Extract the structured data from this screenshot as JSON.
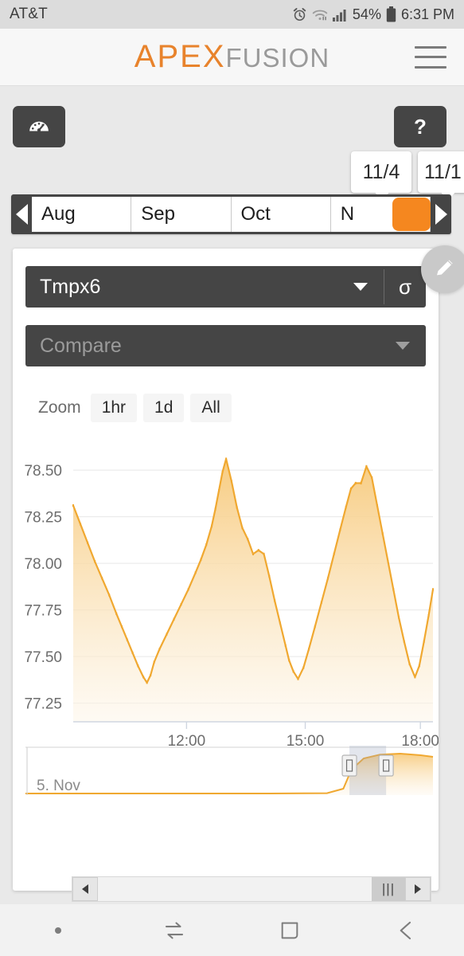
{
  "statusbar": {
    "carrier": "AT&T",
    "battery_percent": "54%",
    "clock": "6:31 PM",
    "icons": [
      "alarm-icon",
      "wifi-icon",
      "signal-icon",
      "battery-icon"
    ]
  },
  "header": {
    "brand_primary": "APEX",
    "brand_secondary": "FUSION",
    "menu_icon": "hamburger-icon",
    "brand_color": "#e8832c"
  },
  "toolbar": {
    "dashboard_icon": "gauge-icon",
    "help_label": "?"
  },
  "date_badges": [
    {
      "label": "11/4"
    },
    {
      "label": "11/1"
    }
  ],
  "month_strip": {
    "prev_icon": "chevron-left-icon",
    "next_icon": "chevron-right-icon",
    "months": [
      "Aug",
      "Sep",
      "Oct",
      "N"
    ],
    "knob_color": "#f5871f"
  },
  "card": {
    "probe_select": {
      "value": "Tmpx6",
      "caret_icon": "chevron-down-icon",
      "sigma_label": "σ"
    },
    "compare_select": {
      "placeholder": "Compare",
      "caret_icon": "chevron-down-icon"
    },
    "zoom": {
      "label": "Zoom",
      "buttons": [
        "1hr",
        "1d",
        "All"
      ]
    },
    "edit_fab_icon": "pencil-icon"
  },
  "navigator": {
    "series_label": "5. Nov",
    "left_arrow_icon": "arrow-left-icon",
    "right_arrow_icon": "arrow-right-icon",
    "thumb_grip": "|||",
    "handle_grip": "||"
  },
  "android_nav": {
    "buttons": [
      "dot-icon",
      "recents-icon",
      "home-icon",
      "back-icon"
    ]
  },
  "chart_data": {
    "type": "area",
    "title": "Tmpx6",
    "xlabel": "",
    "ylabel": "",
    "line_color": "#f0a830",
    "fill_top": "#f7c97a",
    "fill_bottom": "#fdf6ea",
    "ylim": [
      77.15,
      78.62
    ],
    "yticks": [
      78.5,
      78.25,
      78.0,
      77.75,
      77.5,
      77.25
    ],
    "ytick_labels": [
      "78.50",
      "78.25",
      "78.00",
      "77.75",
      "77.50",
      "77.25"
    ],
    "xticks": [
      "12:00",
      "15:00",
      "18:00"
    ],
    "xtick_positions": [
      0.315,
      0.645,
      0.965
    ],
    "grid": true,
    "legend": "none",
    "x": [
      0.0,
      0.02,
      0.04,
      0.06,
      0.08,
      0.1,
      0.12,
      0.135,
      0.15,
      0.165,
      0.18,
      0.195,
      0.205,
      0.215,
      0.225,
      0.24,
      0.26,
      0.28,
      0.3,
      0.32,
      0.34,
      0.355,
      0.37,
      0.385,
      0.395,
      0.405,
      0.415,
      0.425,
      0.44,
      0.455,
      0.47,
      0.485,
      0.5,
      0.515,
      0.53,
      0.545,
      0.56,
      0.575,
      0.59,
      0.6,
      0.612,
      0.625,
      0.64,
      0.655,
      0.672,
      0.69,
      0.708,
      0.725,
      0.742,
      0.758,
      0.772,
      0.785,
      0.8,
      0.815,
      0.83,
      0.845,
      0.86,
      0.875,
      0.89,
      0.905,
      0.92,
      0.935,
      0.95,
      0.962,
      0.975,
      0.988,
      1.0
    ],
    "y": [
      78.31,
      78.21,
      78.11,
      78.01,
      77.92,
      77.83,
      77.73,
      77.66,
      77.59,
      77.52,
      77.45,
      77.39,
      77.36,
      77.4,
      77.47,
      77.54,
      77.62,
      77.7,
      77.78,
      77.86,
      77.95,
      78.02,
      78.1,
      78.2,
      78.29,
      78.39,
      78.49,
      78.56,
      78.44,
      78.3,
      78.19,
      78.13,
      78.05,
      78.07,
      78.05,
      77.93,
      77.8,
      77.68,
      77.56,
      77.48,
      77.42,
      77.38,
      77.44,
      77.54,
      77.66,
      77.79,
      77.92,
      78.05,
      78.18,
      78.3,
      78.4,
      78.43,
      78.43,
      78.52,
      78.46,
      78.31,
      78.16,
      78.01,
      77.86,
      77.71,
      77.58,
      77.46,
      77.39,
      77.45,
      77.58,
      77.72,
      77.86
    ],
    "navigator": {
      "x": [
        0.0,
        0.2,
        0.4,
        0.6,
        0.74,
        0.78,
        0.8,
        0.83,
        0.87,
        0.92,
        0.97,
        1.0
      ],
      "y": [
        77.3,
        77.3,
        77.3,
        77.3,
        77.31,
        77.45,
        78.05,
        78.4,
        78.52,
        78.55,
        78.5,
        78.45
      ],
      "window_start": 0.795,
      "window_end": 0.885
    }
  }
}
